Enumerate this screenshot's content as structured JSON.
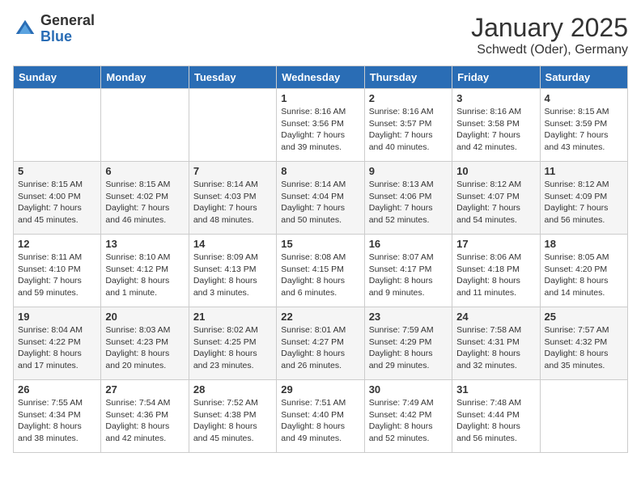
{
  "logo": {
    "general": "General",
    "blue": "Blue"
  },
  "header": {
    "month": "January 2025",
    "location": "Schwedt (Oder), Germany"
  },
  "weekdays": [
    "Sunday",
    "Monday",
    "Tuesday",
    "Wednesday",
    "Thursday",
    "Friday",
    "Saturday"
  ],
  "weeks": [
    [
      {
        "day": "",
        "info": ""
      },
      {
        "day": "",
        "info": ""
      },
      {
        "day": "",
        "info": ""
      },
      {
        "day": "1",
        "info": "Sunrise: 8:16 AM\nSunset: 3:56 PM\nDaylight: 7 hours\nand 39 minutes."
      },
      {
        "day": "2",
        "info": "Sunrise: 8:16 AM\nSunset: 3:57 PM\nDaylight: 7 hours\nand 40 minutes."
      },
      {
        "day": "3",
        "info": "Sunrise: 8:16 AM\nSunset: 3:58 PM\nDaylight: 7 hours\nand 42 minutes."
      },
      {
        "day": "4",
        "info": "Sunrise: 8:15 AM\nSunset: 3:59 PM\nDaylight: 7 hours\nand 43 minutes."
      }
    ],
    [
      {
        "day": "5",
        "info": "Sunrise: 8:15 AM\nSunset: 4:00 PM\nDaylight: 7 hours\nand 45 minutes."
      },
      {
        "day": "6",
        "info": "Sunrise: 8:15 AM\nSunset: 4:02 PM\nDaylight: 7 hours\nand 46 minutes."
      },
      {
        "day": "7",
        "info": "Sunrise: 8:14 AM\nSunset: 4:03 PM\nDaylight: 7 hours\nand 48 minutes."
      },
      {
        "day": "8",
        "info": "Sunrise: 8:14 AM\nSunset: 4:04 PM\nDaylight: 7 hours\nand 50 minutes."
      },
      {
        "day": "9",
        "info": "Sunrise: 8:13 AM\nSunset: 4:06 PM\nDaylight: 7 hours\nand 52 minutes."
      },
      {
        "day": "10",
        "info": "Sunrise: 8:12 AM\nSunset: 4:07 PM\nDaylight: 7 hours\nand 54 minutes."
      },
      {
        "day": "11",
        "info": "Sunrise: 8:12 AM\nSunset: 4:09 PM\nDaylight: 7 hours\nand 56 minutes."
      }
    ],
    [
      {
        "day": "12",
        "info": "Sunrise: 8:11 AM\nSunset: 4:10 PM\nDaylight: 7 hours\nand 59 minutes."
      },
      {
        "day": "13",
        "info": "Sunrise: 8:10 AM\nSunset: 4:12 PM\nDaylight: 8 hours\nand 1 minute."
      },
      {
        "day": "14",
        "info": "Sunrise: 8:09 AM\nSunset: 4:13 PM\nDaylight: 8 hours\nand 3 minutes."
      },
      {
        "day": "15",
        "info": "Sunrise: 8:08 AM\nSunset: 4:15 PM\nDaylight: 8 hours\nand 6 minutes."
      },
      {
        "day": "16",
        "info": "Sunrise: 8:07 AM\nSunset: 4:17 PM\nDaylight: 8 hours\nand 9 minutes."
      },
      {
        "day": "17",
        "info": "Sunrise: 8:06 AM\nSunset: 4:18 PM\nDaylight: 8 hours\nand 11 minutes."
      },
      {
        "day": "18",
        "info": "Sunrise: 8:05 AM\nSunset: 4:20 PM\nDaylight: 8 hours\nand 14 minutes."
      }
    ],
    [
      {
        "day": "19",
        "info": "Sunrise: 8:04 AM\nSunset: 4:22 PM\nDaylight: 8 hours\nand 17 minutes."
      },
      {
        "day": "20",
        "info": "Sunrise: 8:03 AM\nSunset: 4:23 PM\nDaylight: 8 hours\nand 20 minutes."
      },
      {
        "day": "21",
        "info": "Sunrise: 8:02 AM\nSunset: 4:25 PM\nDaylight: 8 hours\nand 23 minutes."
      },
      {
        "day": "22",
        "info": "Sunrise: 8:01 AM\nSunset: 4:27 PM\nDaylight: 8 hours\nand 26 minutes."
      },
      {
        "day": "23",
        "info": "Sunrise: 7:59 AM\nSunset: 4:29 PM\nDaylight: 8 hours\nand 29 minutes."
      },
      {
        "day": "24",
        "info": "Sunrise: 7:58 AM\nSunset: 4:31 PM\nDaylight: 8 hours\nand 32 minutes."
      },
      {
        "day": "25",
        "info": "Sunrise: 7:57 AM\nSunset: 4:32 PM\nDaylight: 8 hours\nand 35 minutes."
      }
    ],
    [
      {
        "day": "26",
        "info": "Sunrise: 7:55 AM\nSunset: 4:34 PM\nDaylight: 8 hours\nand 38 minutes."
      },
      {
        "day": "27",
        "info": "Sunrise: 7:54 AM\nSunset: 4:36 PM\nDaylight: 8 hours\nand 42 minutes."
      },
      {
        "day": "28",
        "info": "Sunrise: 7:52 AM\nSunset: 4:38 PM\nDaylight: 8 hours\nand 45 minutes."
      },
      {
        "day": "29",
        "info": "Sunrise: 7:51 AM\nSunset: 4:40 PM\nDaylight: 8 hours\nand 49 minutes."
      },
      {
        "day": "30",
        "info": "Sunrise: 7:49 AM\nSunset: 4:42 PM\nDaylight: 8 hours\nand 52 minutes."
      },
      {
        "day": "31",
        "info": "Sunrise: 7:48 AM\nSunset: 4:44 PM\nDaylight: 8 hours\nand 56 minutes."
      },
      {
        "day": "",
        "info": ""
      }
    ]
  ]
}
